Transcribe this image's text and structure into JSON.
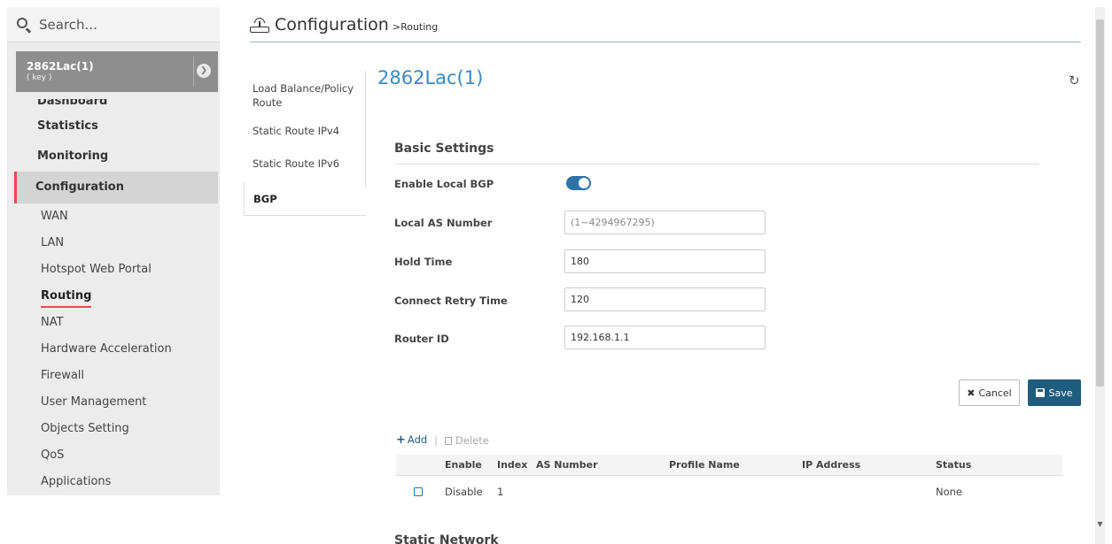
{
  "search": {
    "placeholder": "Search..."
  },
  "device": {
    "name": "2862Lac(1)",
    "subtitle": "( key )"
  },
  "sidebar": {
    "items": [
      {
        "label": "Dashboard"
      },
      {
        "label": "Statistics"
      },
      {
        "label": "Monitoring"
      },
      {
        "label": "Configuration"
      }
    ],
    "sub_items": [
      {
        "label": "WAN"
      },
      {
        "label": "LAN"
      },
      {
        "label": "Hotspot Web Portal"
      },
      {
        "label": "Routing"
      },
      {
        "label": "NAT"
      },
      {
        "label": "Hardware Acceleration"
      },
      {
        "label": "Firewall"
      },
      {
        "label": "User Management"
      },
      {
        "label": "Objects Setting"
      },
      {
        "label": "QoS"
      },
      {
        "label": "Applications"
      }
    ],
    "active_item": "Configuration",
    "current_sub_item": "Routing"
  },
  "header": {
    "title": "Configuration",
    "breadcrumb": ">Routing"
  },
  "subnav": {
    "items": [
      {
        "label": "Load Balance/Policy Route"
      },
      {
        "label": "Static Route IPv4"
      },
      {
        "label": "Static Route IPv6"
      },
      {
        "label": "BGP"
      }
    ],
    "active": "BGP"
  },
  "main": {
    "device_heading": "2862Lac(1)",
    "refresh_icon": "refresh-icon",
    "section_title": "Basic Settings",
    "fields": {
      "enable_local_bgp": {
        "label": "Enable Local BGP",
        "value": true
      },
      "local_as_number": {
        "label": "Local AS Number",
        "value": "",
        "placeholder": "(1~4294967295)"
      },
      "hold_time": {
        "label": "Hold Time",
        "value": "180"
      },
      "connect_retry_time": {
        "label": "Connect Retry Time",
        "value": "120"
      },
      "router_id": {
        "label": "Router ID",
        "value": "192.168.1.1"
      }
    },
    "buttons": {
      "cancel": "Cancel",
      "save": "Save"
    },
    "table_actions": {
      "add": "Add",
      "separator": "|",
      "delete": "Delete"
    },
    "table": {
      "columns": [
        "Enable",
        "Index",
        "AS Number",
        "Profile Name",
        "IP Address",
        "Status"
      ],
      "rows": [
        {
          "enable": "Disable",
          "index": "1",
          "as_number": "",
          "profile_name": "",
          "ip_address": "",
          "status": "None"
        }
      ]
    },
    "next_section_title": "Static Network"
  },
  "colors": {
    "accent_blue": "#3b8ac4",
    "toggle_blue": "#2e73a8",
    "save_button": "#1f5c7e",
    "active_marker": "#e04e4e",
    "sidebar_bg": "#ececec",
    "device_bg": "#8e8e8e"
  }
}
